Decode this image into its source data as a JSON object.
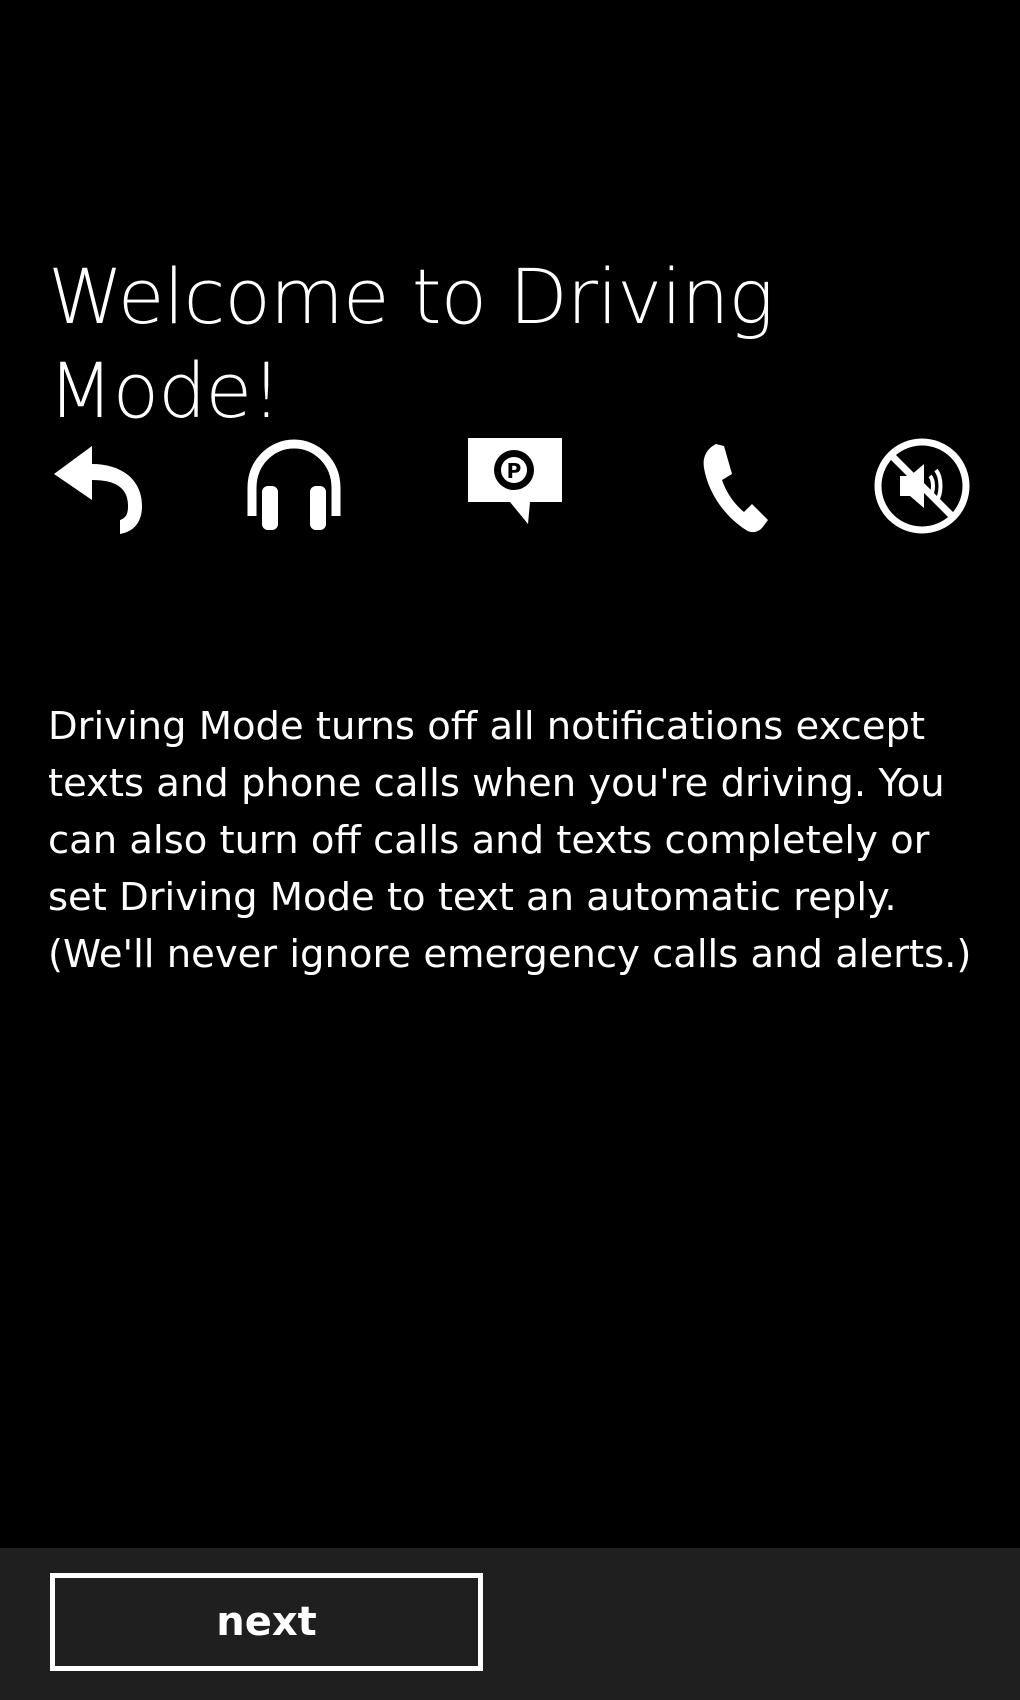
{
  "page": {
    "title": "Welcome to Driving Mode!",
    "description": "Driving Mode turns off all notifications except texts and phone calls when you're driving. You can also turn off calls and texts completely or set Driving Mode to text an automatic reply. (We'll never ignore emergency calls and alerts.)"
  },
  "icons": [
    "reply-icon",
    "headphones-icon",
    "parking-message-icon",
    "phone-icon",
    "mute-speaker-icon"
  ],
  "app_bar": {
    "next_label": "next"
  },
  "colors": {
    "background": "#000000",
    "text": "#ffffff",
    "app_bar": "#1f1f1f"
  }
}
